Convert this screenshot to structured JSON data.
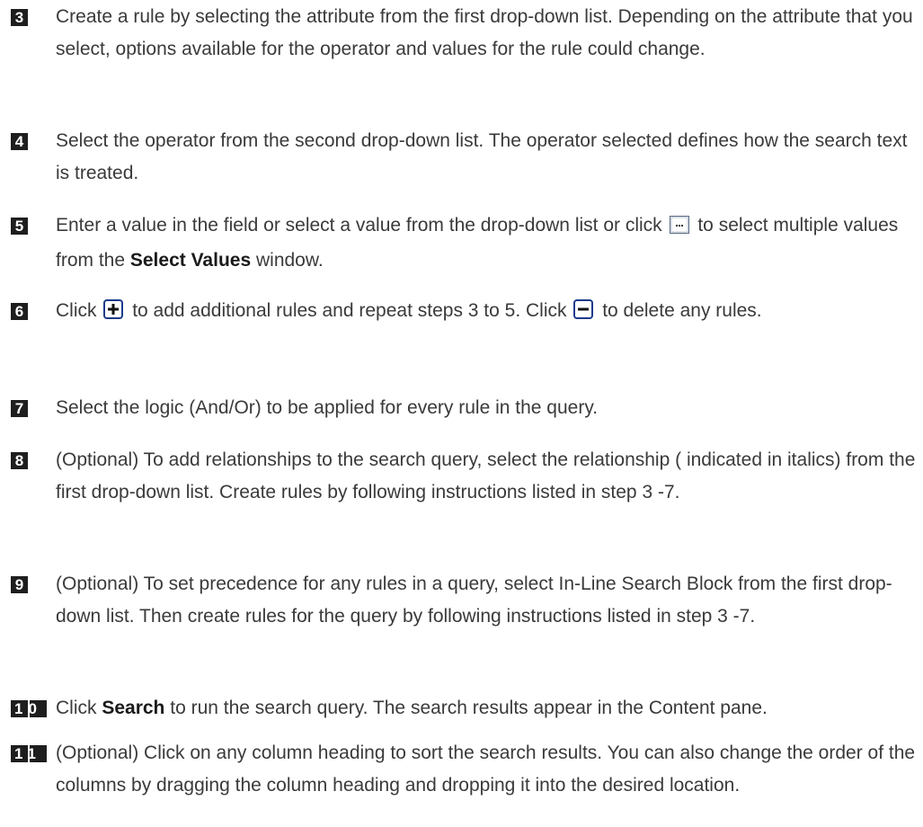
{
  "steps": [
    {
      "number": "3",
      "text": "Create a rule by selecting the attribute from the first drop-down list. Depending on the attribute that you select, options available for the operator and values for the rule could change."
    },
    {
      "number": "4",
      "text": "Select the operator from the second drop-down list. The operator selected defines how the search text is treated."
    },
    {
      "number": "5",
      "text_a": "Enter a value in the field or select a value from the drop-down list or click",
      "text_b": "to select multiple values from the",
      "bold": "Select Values",
      "text_c": "window.",
      "icon": "ellipsis-button-icon"
    },
    {
      "number": "6",
      "text_a": "Click",
      "text_b": "to add additional rules and repeat steps 3 to 5. Click",
      "text_c": "to delete any rules.",
      "icon_add": "plus-button-icon",
      "icon_remove": "minus-button-icon"
    },
    {
      "number": "7",
      "text": "Select the logic (And/Or) to be applied for every rule in the query."
    },
    {
      "number": "8",
      "text": "(Optional) To add relationships to the search query, select the relationship ( indicated in italics) from the first drop-down list. Create rules by following instructions listed in step 3 -7."
    },
    {
      "number": "9",
      "text": "(Optional) To set precedence for any rules in a query, select In-Line Search Block from the first drop-down list. Then create rules for the query by following instructions listed in step 3 -7."
    },
    {
      "number": "10",
      "text_a": "Click",
      "bold": "Search",
      "text_b": "to run the search query. The search results appear in the Content pane."
    },
    {
      "number": "11",
      "text": "(Optional) Click on any column heading to sort the search results. You can also change the order of the columns by dragging the column heading and dropping it into the desired location."
    }
  ],
  "colors": {
    "text": "#3a3a3a",
    "badge_bg": "#1e1e1e",
    "badge_fg": "#ffffff",
    "icon_border": "#1a3a8a"
  }
}
